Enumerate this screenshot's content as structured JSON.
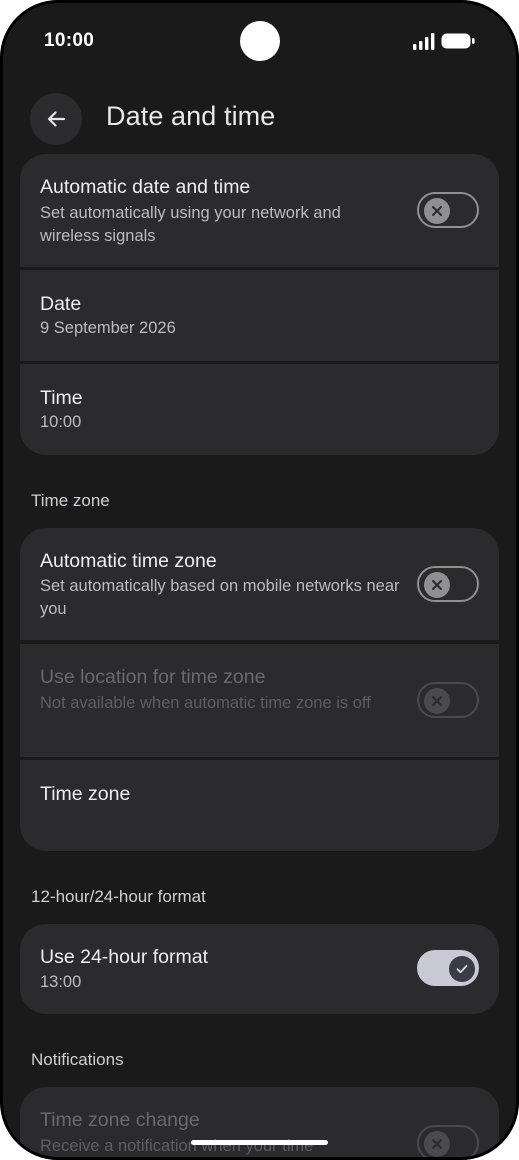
{
  "status_bar": {
    "time": "10:00"
  },
  "header": {
    "title": "Date and time"
  },
  "date_time_group": {
    "automatic": {
      "title": "Automatic date and time",
      "subtitle": "Set automatically using your network and wireless signals",
      "toggle_on": false
    },
    "date": {
      "title": "Date",
      "value": "9 September 2026"
    },
    "time": {
      "title": "Time",
      "value": "10:00"
    }
  },
  "time_zone_section": {
    "header": "Time zone",
    "automatic": {
      "title": "Automatic time zone",
      "subtitle": "Set automatically based on mobile networks near you",
      "toggle_on": false
    },
    "use_location": {
      "title": "Use location for time zone",
      "subtitle": "Not available when automatic time zone is off",
      "toggle_on": false,
      "disabled": true
    },
    "time_zone": {
      "title": "Time zone"
    }
  },
  "format_section": {
    "header": "12-hour/24-hour format",
    "use_24_hour": {
      "title": "Use 24-hour format",
      "value": "13:00",
      "toggle_on": true
    }
  },
  "notifications_section": {
    "header": "Notifications",
    "time_zone_change": {
      "title": "Time zone change",
      "subtitle": "Receive a notification when your time",
      "toggle_on": false,
      "disabled": true
    }
  },
  "colors": {
    "background": "#1a1a1b",
    "card": "#2b2b2d",
    "toggle_on_track": "#c9c9d6"
  },
  "icons": {
    "back": "arrow-left-icon",
    "toggle_off": "close-icon",
    "toggle_on": "check-icon"
  }
}
